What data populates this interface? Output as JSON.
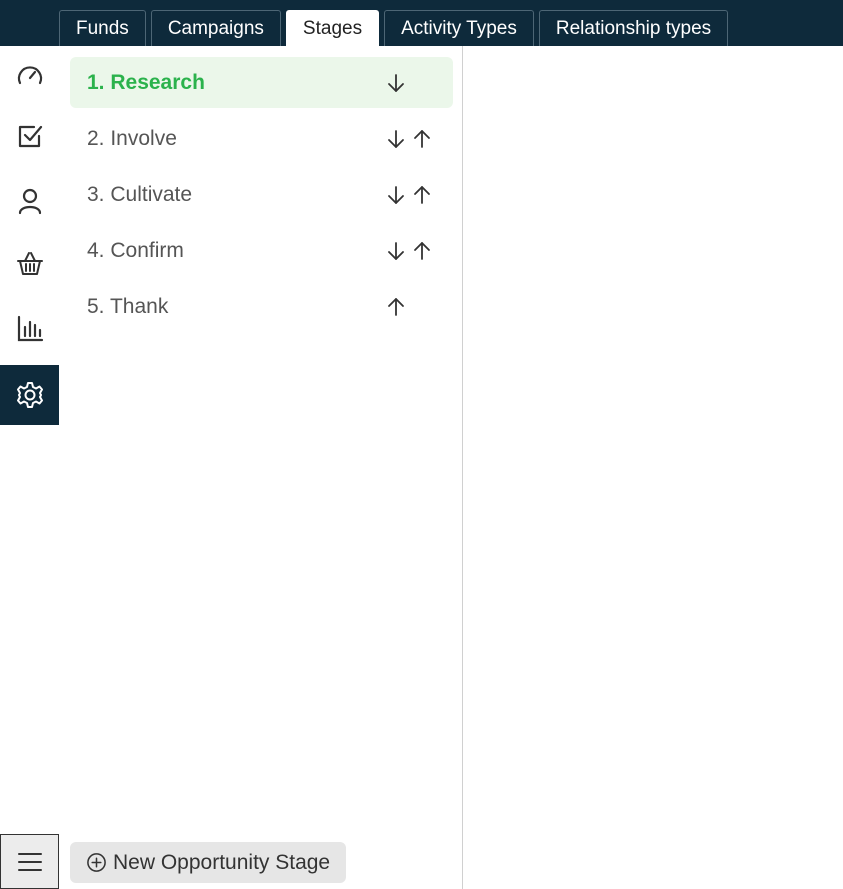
{
  "tabs": [
    {
      "label": "Funds",
      "active": false
    },
    {
      "label": "Campaigns",
      "active": false
    },
    {
      "label": "Stages",
      "active": true
    },
    {
      "label": "Activity Types",
      "active": false
    },
    {
      "label": "Relationship types",
      "active": false
    }
  ],
  "rail": {
    "items": [
      {
        "icon": "gauge-icon"
      },
      {
        "icon": "checkbox-icon"
      },
      {
        "icon": "person-icon"
      },
      {
        "icon": "basket-icon"
      },
      {
        "icon": "bar-chart-icon"
      },
      {
        "icon": "gear-icon",
        "active": true
      }
    ],
    "menu_icon": "hamburger-icon"
  },
  "stages": [
    {
      "label": "1. Research",
      "selected": true,
      "down": true,
      "up": false
    },
    {
      "label": "2. Involve",
      "selected": false,
      "down": true,
      "up": true
    },
    {
      "label": "3. Cultivate",
      "selected": false,
      "down": true,
      "up": true
    },
    {
      "label": "4. Confirm",
      "selected": false,
      "down": true,
      "up": true
    },
    {
      "label": "5. Thank",
      "selected": false,
      "down": false,
      "up": true
    }
  ],
  "new_stage_button": {
    "label": "New Opportunity Stage",
    "icon": "plus-circle-icon"
  },
  "colors": {
    "header_bg": "#0e2a3b",
    "selected_bg": "#ebf7ea",
    "selected_text": "#2bb24c"
  }
}
